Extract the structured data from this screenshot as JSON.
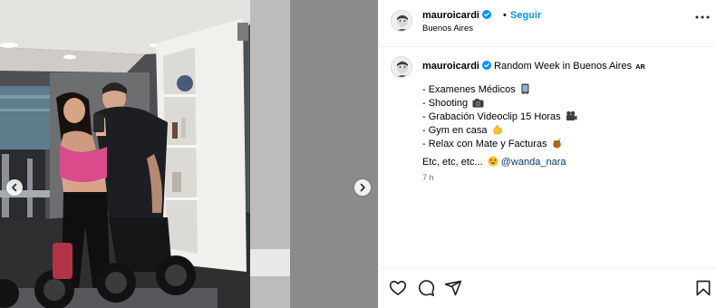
{
  "post": {
    "author": {
      "username": "mauroicardi",
      "verified": true,
      "follow_label": "Seguir",
      "separator": "•",
      "location": "Buenos Aires"
    },
    "caption": {
      "username": "mauroicardi",
      "title": "Random Week in Buenos Aires",
      "region_tag": "AR",
      "items": [
        {
          "text": "- Examenes Médicos",
          "emoji": "mobile-phone"
        },
        {
          "text": "- Shooting",
          "emoji": "camera"
        },
        {
          "text": "- Grabación Videoclip 15 Horas",
          "emoji": "film-camera"
        },
        {
          "text": "- Gym en casa",
          "emoji": "flexed-biceps"
        },
        {
          "text": "- Relax con Mate y Facturas",
          "emoji": "mate"
        }
      ],
      "closing": "Etc, etc, etc...",
      "closing_emoji": "star-struck-face",
      "mention": "@wanda_nara",
      "time": "7 h"
    },
    "icons": {
      "more": "more-options-icon",
      "prev": "chevron-left-icon",
      "next": "chevron-right-icon",
      "like": "heart-icon",
      "comment": "comment-icon",
      "share": "share-icon",
      "save": "bookmark-icon",
      "verified": "verified-badge-icon"
    },
    "colors": {
      "link": "#0095f6",
      "mention": "#00376b",
      "verified": "#0095f6",
      "muted": "#737373"
    }
  }
}
